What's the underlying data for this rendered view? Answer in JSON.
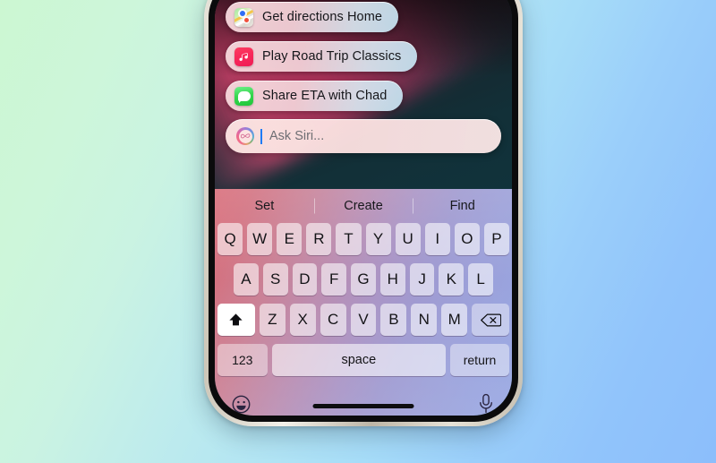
{
  "device": {
    "name": "iphone",
    "home_indicator": "home-indicator"
  },
  "siri_suggestions": [
    {
      "icon": "maps-app-icon",
      "label": "Get directions Home"
    },
    {
      "icon": "music-app-icon",
      "label": "Play Road Trip Classics"
    },
    {
      "icon": "messages-app-icon",
      "label": "Share ETA with Chad"
    }
  ],
  "siri_input": {
    "icon": "siri-orb-icon",
    "placeholder": "Ask Siri...",
    "value": ""
  },
  "keyboard": {
    "predictive": [
      "Set",
      "Create",
      "Find"
    ],
    "row1": [
      "Q",
      "W",
      "E",
      "R",
      "T",
      "Y",
      "U",
      "I",
      "O",
      "P"
    ],
    "row2": [
      "A",
      "S",
      "D",
      "F",
      "G",
      "H",
      "J",
      "K",
      "L"
    ],
    "row3": [
      "Z",
      "X",
      "C",
      "V",
      "B",
      "N",
      "M"
    ],
    "shift_label": "shift-icon",
    "delete_label": "delete-icon",
    "numbers_label": "123",
    "space_label": "space",
    "return_label": "return",
    "emoji_label": "emoji-icon",
    "dictation_label": "microphone-icon"
  },
  "colors": {
    "page_gradient_start": "#ccf7d2",
    "page_gradient_end": "#8cbefb",
    "keyboard_gradient_start": "#d86b78",
    "keyboard_gradient_end": "#96a6e2",
    "wallpaper_dark": "#123038",
    "wallpaper_streak": "#e84a78",
    "caret": "#1f7bf5",
    "chip_background": "#f6d7db",
    "music_icon": "#f8285a",
    "messages_icon": "#38d74f"
  }
}
